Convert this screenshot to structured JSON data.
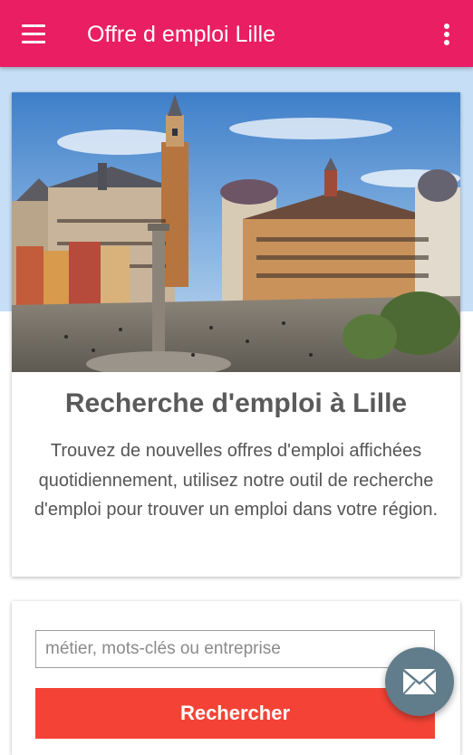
{
  "app_bar": {
    "title": "Offre d emploi Lille",
    "menu_icon": "hamburger-menu-icon",
    "overflow_icon": "more-vert-icon",
    "color": "#e91e63"
  },
  "hero": {
    "image": "photo of Lille Grand Place with belfry and historic buildings",
    "heading": "Recherche d'emploi à Lille",
    "description": "Trouvez de nouvelles offres d'emploi affichées quotidiennement, utilisez notre outil de recherche d'emploi pour trouver un emploi dans votre région."
  },
  "search": {
    "placeholder": "métier, mots-clés ou entreprise",
    "value": "",
    "button_label": "Rechercher",
    "button_color": "#f44336"
  },
  "fab": {
    "icon": "mail-icon",
    "color": "#617d8b"
  }
}
